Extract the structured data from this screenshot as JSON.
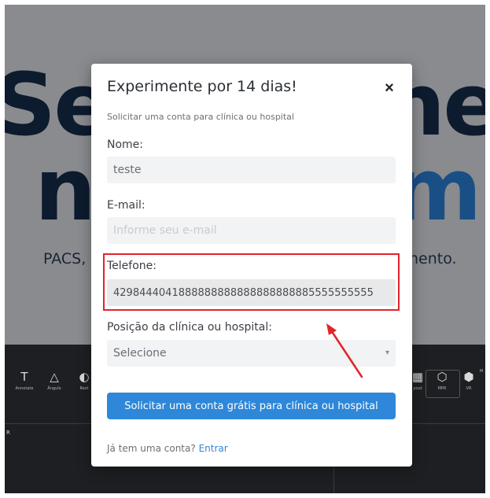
{
  "background": {
    "hero_left_top": "Seu",
    "hero_right_top": "ne",
    "hero_left_mid": "n",
    "hero_right_mid": "m",
    "hero_sub_left": "PACS,",
    "hero_sub_right": "nento.",
    "toolbar_left": [
      {
        "glyph": "T",
        "label": "Annotate"
      },
      {
        "glyph": "△",
        "label": "Ângulo"
      },
      {
        "glyph": "◐",
        "label": "Rest"
      }
    ],
    "toolbar_right": [
      {
        "glyph": "▦",
        "label": "yout"
      },
      {
        "glyph": "⬡",
        "label": "MPR"
      },
      {
        "glyph": "⬢",
        "label": "VR"
      },
      {
        "glyph": "",
        "label": "M"
      }
    ],
    "side_label": "R"
  },
  "modal": {
    "title": "Experimente por 14 dias!",
    "close_label": "×",
    "subtitle": "Solicitar uma conta para clínica ou hospital",
    "name": {
      "label": "Nome:",
      "value": "teste"
    },
    "email": {
      "label": "E-mail:",
      "value": "",
      "placeholder": "Informe seu e-mail"
    },
    "phone": {
      "label": "Telefone:",
      "value": "4298444041888888888888888888885555555555"
    },
    "position": {
      "label": "Posição da clínica ou hospital:",
      "selected": "Selecione"
    },
    "submit_label": "Solicitar uma conta grátis para clínica ou hospital",
    "login_prompt": "Já tem uma conta?",
    "login_link": "Entrar"
  },
  "colors": {
    "accent": "#2e87d8",
    "highlight": "#e0242b",
    "backdrop": "#8a8b8f",
    "app_bg": "#1e1f22"
  }
}
